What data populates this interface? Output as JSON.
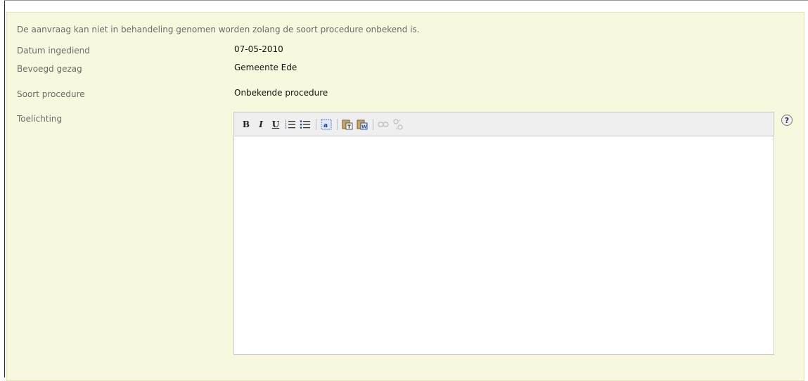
{
  "notice": "De aanvraag kan niet in behandeling genomen worden zolang de soort procedure onbekend is.",
  "fields": [
    {
      "label": "Datum ingediend",
      "value": "07-05-2010"
    },
    {
      "label": "Bevoegd gezag",
      "value": "Gemeente Ede"
    },
    {
      "label": "Soort procedure",
      "value": "Onbekende procedure"
    }
  ],
  "toelichting": {
    "label": "Toelichting",
    "content": ""
  },
  "toolbar": {
    "bold": "B",
    "italic": "I",
    "underline": "U",
    "icons": [
      "bold-icon",
      "italic-icon",
      "underline-icon",
      "ordered-list-icon",
      "unordered-list-icon",
      "select-all-icon",
      "paste-text-icon",
      "paste-word-icon",
      "link-icon",
      "unlink-icon"
    ]
  },
  "help": {
    "symbol": "?"
  },
  "colors": {
    "panel_background": "#f8f8df",
    "label_text": "#6b6b6b",
    "value_text": "#111111"
  }
}
